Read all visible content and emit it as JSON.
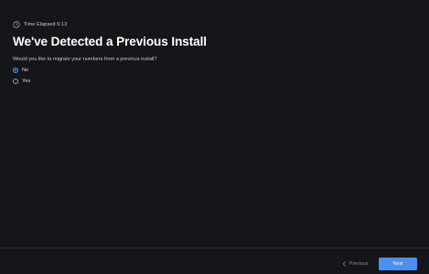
{
  "status": {
    "icon": "clock-icon",
    "text": "Time Elapsed 6:13"
  },
  "page": {
    "title": "We've Detected a Previous Install",
    "question": "Would you like to migrate your numbers from a previous install?"
  },
  "options": [
    {
      "label": "No",
      "selected": true
    },
    {
      "label": "Yes",
      "selected": false
    }
  ],
  "footer": {
    "previous_label": "Previous",
    "previous_icon": "chevron-left-icon",
    "next_label": "Next"
  },
  "colors": {
    "background": "#151619",
    "accent": "#4c8ff0",
    "text": "#ffffff"
  }
}
